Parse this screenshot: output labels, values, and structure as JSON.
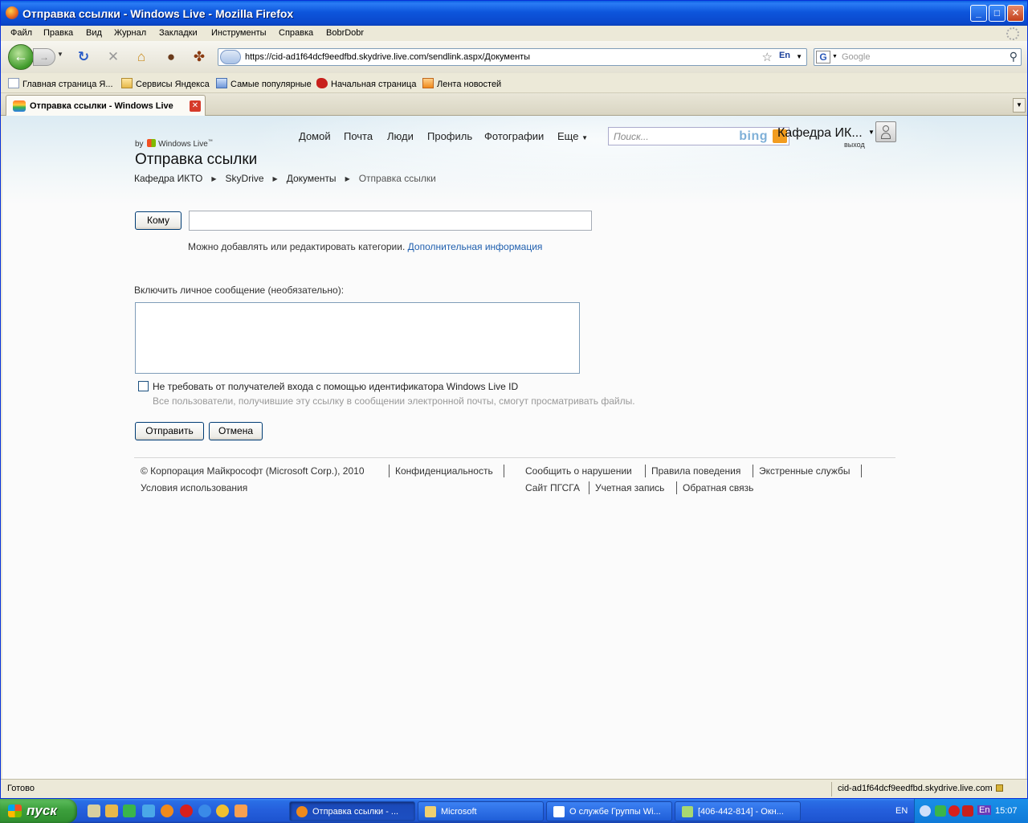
{
  "window": {
    "title": "Отправка ссылки - Windows Live - Mozilla Firefox",
    "min_glyph": "_",
    "max_glyph": "□",
    "close_glyph": "✕"
  },
  "menu": [
    "Файл",
    "Правка",
    "Вид",
    "Журнал",
    "Закладки",
    "Инструменты",
    "Справка",
    "BobrDobr"
  ],
  "navbar": {
    "url": "https://cid-ad1f64dcf9eedfbd.skydrive.live.com/sendlink.aspx/Документы",
    "lang": "En",
    "search_placeholder": "Google",
    "icons": [
      "back-icon",
      "forward-icon",
      "reload-icon",
      "stop-icon",
      "home-icon",
      "bookmark-star-icon",
      "search-icon"
    ]
  },
  "bookmarks": [
    "Главная страница Я...",
    "Сервисы Яндекса",
    "Самые популярные",
    "Начальная страница",
    "Лента новостей"
  ],
  "tab": {
    "label": "Отправка ссылки - Windows Live"
  },
  "live_header": {
    "nav": [
      "Домой",
      "Почта",
      "Люди",
      "Профиль",
      "Фотографии",
      "Еще"
    ],
    "search_placeholder": "Поиск...",
    "bing": "bing",
    "user": "Кафедра ИК...",
    "signout": "выход",
    "brand_by": "by",
    "brand_name": "Windows Live",
    "brand_tm": "™"
  },
  "page": {
    "title": "Отправка ссылки",
    "breadcrumb": [
      "Кафедра ИКТО",
      "SkyDrive",
      "Документы",
      "Отправка ссылки"
    ],
    "to_button": "Кому",
    "to_help": "Можно добавлять или редактировать категории.",
    "to_help_link": "Дополнительная информация",
    "message_label": "Включить личное сообщение (необязательно):",
    "checkbox_label": "Не требовать от получателей входа с помощью идентификатора Windows Live ID",
    "checkbox_hint": "Все пользователи, получившие эту ссылку в сообщении электронной почты, смогут просматривать файлы.",
    "send_button": "Отправить",
    "cancel_button": "Отмена"
  },
  "footer": {
    "copyright": "© Корпорация Майкрософт (Microsoft Corp.), 2010",
    "privacy": "Конфиденциальность",
    "terms": "Условия использования",
    "report": "Сообщить о нарушении",
    "conduct": "Правила поведения",
    "emergency": "Экстренные службы",
    "site": "Сайт ПГСГА",
    "account": "Учетная запись",
    "feedback": "Обратная связь"
  },
  "status": {
    "text": "Готово",
    "host": "cid-ad1f64dcf9eedfbd.skydrive.live.com"
  },
  "taskbar": {
    "start": "пуск",
    "tasks": [
      "Отправка ссылки - ...",
      "Microsoft",
      "О службе Группы Wi...",
      "[406-442-814] - Окн..."
    ],
    "lang": "EN",
    "tray_lang": "En",
    "clock": "15:07"
  },
  "colors": {
    "link": "#1f5fae",
    "titlebar": "#0a48cc",
    "taskbar": "#245edb",
    "start": "#3c9f3c"
  }
}
